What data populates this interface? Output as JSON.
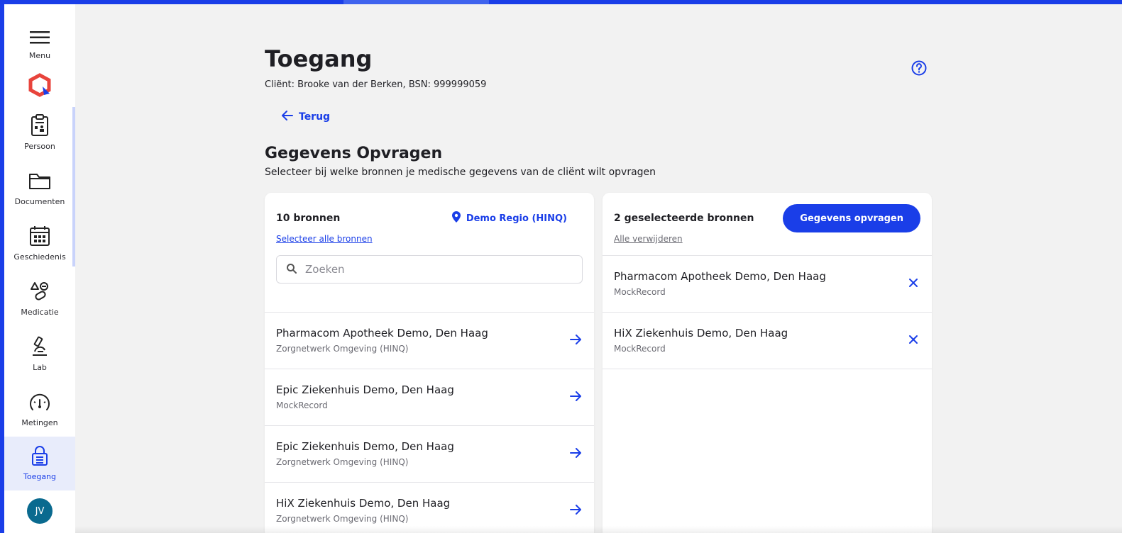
{
  "colors": {
    "accent": "#1a3ee8",
    "avatar": "#0a6a8f",
    "logo": "#e8443c"
  },
  "sidebar": {
    "menu_label": "Menu",
    "items": [
      {
        "label": "Persoon",
        "icon": "clipboard-person-icon"
      },
      {
        "label": "Documenten",
        "icon": "folder-icon"
      },
      {
        "label": "Geschiedenis",
        "icon": "calendar-icon"
      },
      {
        "label": "Medicatie",
        "icon": "medication-shapes-icon"
      },
      {
        "label": "Lab",
        "icon": "microscope-icon"
      },
      {
        "label": "Metingen",
        "icon": "gauge-icon"
      },
      {
        "label": "Toegang",
        "icon": "lock-icon",
        "active": true
      }
    ],
    "avatar_initials": "JV"
  },
  "page": {
    "title": "Toegang",
    "client": "Cliënt: Brooke van der Berken, BSN: 999999059",
    "back_label": "Terug",
    "section_title": "Gegevens Opvragen",
    "section_subtitle": "Selecteer bij welke bronnen je medische gegevens van de cliënt wilt opvragen"
  },
  "sources": {
    "count_label": "10 bronnen",
    "region_label": "Demo Regio (HINQ)",
    "select_all_label": "Selecteer alle bronnen",
    "search_placeholder": "Zoeken",
    "items": [
      {
        "name": "Pharmacom Apotheek Demo, Den Haag",
        "meta": "Zorgnetwerk Omgeving (HINQ)"
      },
      {
        "name": "Epic Ziekenhuis Demo, Den Haag",
        "meta": "MockRecord"
      },
      {
        "name": "Epic Ziekenhuis Demo, Den Haag",
        "meta": "Zorgnetwerk Omgeving (HINQ)"
      },
      {
        "name": "HiX Ziekenhuis Demo, Den Haag",
        "meta": "Zorgnetwerk Omgeving (HINQ)"
      }
    ]
  },
  "selected": {
    "count_label": "2 geselecteerde bronnen",
    "request_button": "Gegevens opvragen",
    "remove_all_label": "Alle verwijderen",
    "items": [
      {
        "name": "Pharmacom Apotheek Demo, Den Haag",
        "meta": "MockRecord"
      },
      {
        "name": "HiX Ziekenhuis Demo, Den Haag",
        "meta": "MockRecord"
      }
    ]
  }
}
